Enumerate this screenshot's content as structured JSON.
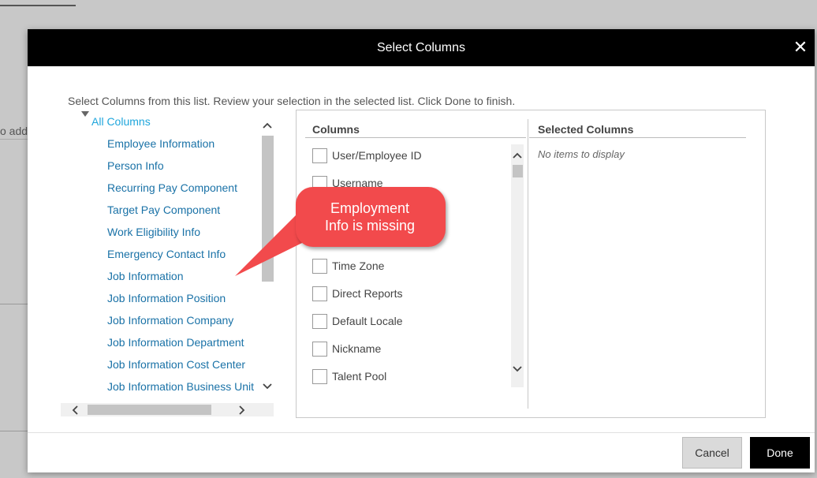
{
  "background": {
    "partial_text": "o add"
  },
  "dialog": {
    "title": "Select Columns",
    "close_glyph": "✕",
    "instructions": "Select Columns from this list. Review your selection in the selected list. Click Done to finish."
  },
  "tree": {
    "root_label": "All Columns",
    "items": [
      "Employee Information",
      "Person Info",
      "Recurring Pay Component",
      "Target Pay Component",
      "Work Eligibility Info",
      "Emergency Contact Info",
      "Job Information",
      "Job Information Position",
      "Job Information Company",
      "Job Information Department",
      "Job Information Cost Center",
      "Job Information Business Unit"
    ]
  },
  "columns": {
    "header": "Columns",
    "items": [
      "User/Employee ID",
      "Username",
      "",
      "",
      "Time Zone",
      "Direct Reports",
      "Default Locale",
      "Nickname",
      "Talent Pool"
    ]
  },
  "selected": {
    "header": "Selected Columns",
    "empty_text": "No items to display"
  },
  "callout": {
    "line1": "Employment",
    "line2": "Info is missing",
    "color": "#f24a4c"
  },
  "footer": {
    "cancel_label": "Cancel",
    "done_label": "Done"
  },
  "icons": {
    "scroll_up": "up-arrow-icon",
    "scroll_down": "down-arrow-icon",
    "scroll_left": "left-arrow-icon",
    "scroll_right": "right-arrow-icon",
    "tree_expand": "triangle-down-icon",
    "close": "close-icon"
  }
}
